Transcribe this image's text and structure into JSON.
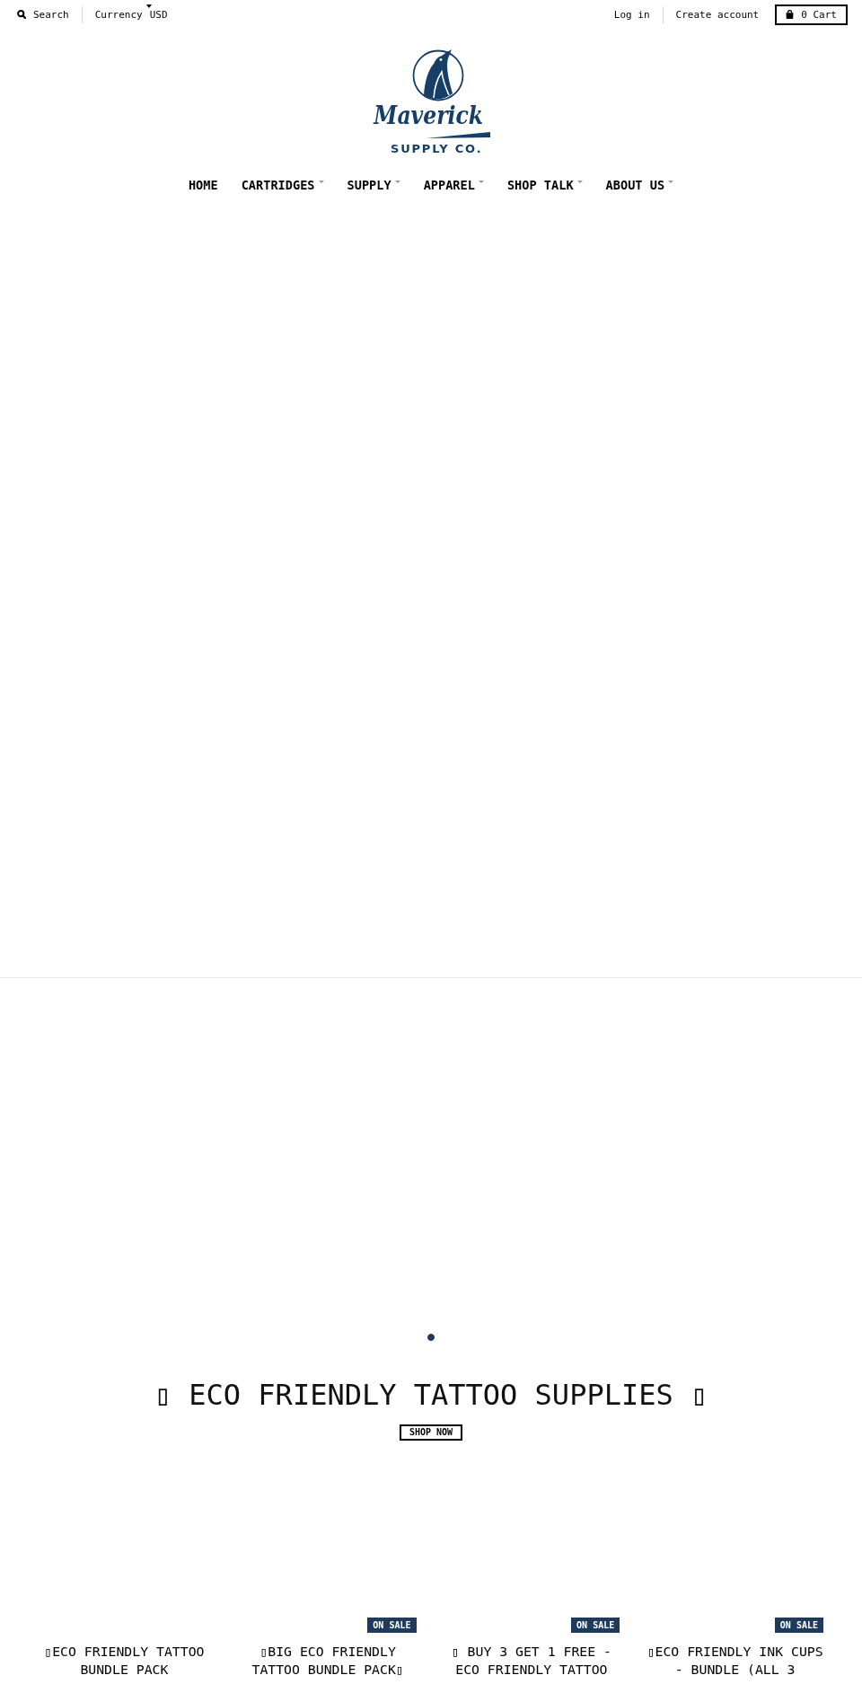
{
  "top_bar": {
    "search": {
      "label": "Search"
    },
    "currency": {
      "label": "Currency",
      "value": "USD"
    },
    "account_links": [
      "Log in",
      "Create account"
    ],
    "cart": {
      "count": "0",
      "label": "Cart"
    }
  },
  "logo": {
    "wordmark": "Maverick",
    "tagline": "SUPPLY CO."
  },
  "nav": [
    {
      "label": "HOME",
      "has_dropdown": false
    },
    {
      "label": "CARTRIDGES",
      "has_dropdown": true
    },
    {
      "label": "SUPPLY",
      "has_dropdown": true
    },
    {
      "label": "APPAREL",
      "has_dropdown": true
    },
    {
      "label": "SHOP TALK",
      "has_dropdown": true
    },
    {
      "label": "ABOUT US",
      "has_dropdown": true
    }
  ],
  "slideshow": {
    "dots": [
      {
        "selected": true
      }
    ],
    "heading": "▯ ECO FRIENDLY TATTOO SUPPLIES ▯",
    "button": "SHOP NOW"
  },
  "products": [
    {
      "title": "▯ECO FRIENDLY TATTOO BUNDLE PACK"
    },
    {
      "title": "▯BIG ECO FRIENDLY TATTOO BUNDLE PACK▯",
      "badge": "ON SALE"
    },
    {
      "title": "▯ BUY 3 GET 1 FREE - ECO FRIENDLY TATTOO",
      "badge": "ON SALE"
    },
    {
      "title": "▯ECO FRIENDLY INK CUPS - BUNDLE (ALL 3",
      "badge": "ON SALE"
    }
  ]
}
